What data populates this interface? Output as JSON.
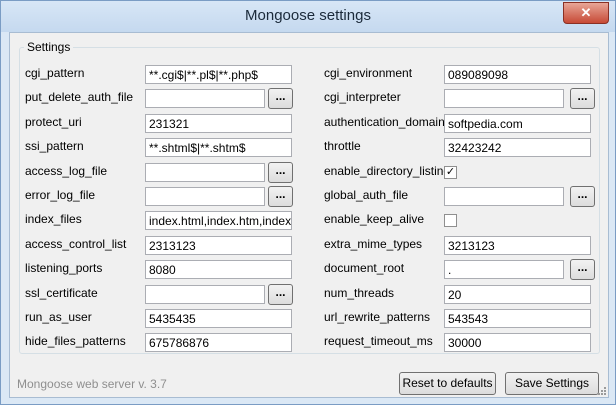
{
  "window": {
    "title": "Mongoose settings",
    "close_glyph": "✕"
  },
  "group_title": "Settings",
  "browse_label": "...",
  "checkmark_glyph": "✓",
  "left": [
    {
      "label": "cgi_pattern",
      "value": "**.cgi$|**.pl$|**.php$",
      "browse": false
    },
    {
      "label": "put_delete_auth_file",
      "value": "",
      "browse": true
    },
    {
      "label": "protect_uri",
      "value": "231321",
      "browse": false
    },
    {
      "label": "ssi_pattern",
      "value": "**.shtml$|**.shtm$",
      "browse": false
    },
    {
      "label": "access_log_file",
      "value": "",
      "browse": true
    },
    {
      "label": "error_log_file",
      "value": "",
      "browse": true
    },
    {
      "label": "index_files",
      "value": "index.html,index.htm,index.c",
      "browse": false
    },
    {
      "label": "access_control_list",
      "value": "2313123",
      "browse": false
    },
    {
      "label": "listening_ports",
      "value": "8080",
      "browse": false
    },
    {
      "label": "ssl_certificate",
      "value": "",
      "browse": true
    },
    {
      "label": "run_as_user",
      "value": "5435435",
      "browse": false
    },
    {
      "label": "hide_files_patterns",
      "value": "675786876",
      "browse": false
    }
  ],
  "right": [
    {
      "label": "cgi_environment",
      "value": "089089098",
      "type": "text",
      "browse": false
    },
    {
      "label": "cgi_interpreter",
      "value": "",
      "type": "text",
      "browse": true
    },
    {
      "label": "authentication_domain",
      "value": "softpedia.com",
      "type": "text",
      "browse": false
    },
    {
      "label": "throttle",
      "value": "32423242",
      "type": "text",
      "browse": false
    },
    {
      "label": "enable_directory_listing",
      "checked": true,
      "type": "checkbox"
    },
    {
      "label": "global_auth_file",
      "value": "",
      "type": "text",
      "browse": true
    },
    {
      "label": "enable_keep_alive",
      "checked": false,
      "type": "checkbox"
    },
    {
      "label": "extra_mime_types",
      "value": "3213123",
      "type": "text",
      "browse": false
    },
    {
      "label": "document_root",
      "value": ".",
      "type": "text",
      "browse": true
    },
    {
      "label": "num_threads",
      "value": "20",
      "type": "text",
      "browse": false
    },
    {
      "label": "url_rewrite_patterns",
      "value": "543543",
      "type": "text",
      "browse": false
    },
    {
      "label": "request_timeout_ms",
      "value": "30000",
      "type": "text",
      "browse": false
    }
  ],
  "footer": {
    "version": "Mongoose web server v. 3.7",
    "reset_label": "Reset to defaults",
    "save_label": "Save Settings"
  }
}
